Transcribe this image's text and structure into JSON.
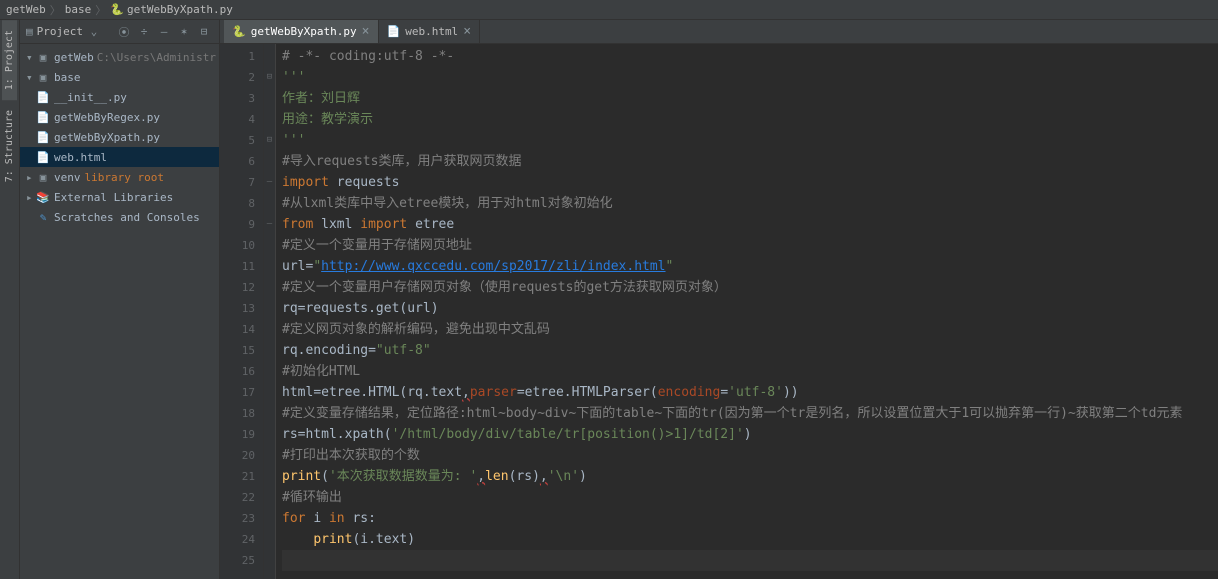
{
  "breadcrumb": {
    "root": "getWeb",
    "mid": "base",
    "leaf": "getWebByXpath.py"
  },
  "side_tabs": {
    "project": "1: Project",
    "structure": "7: Structure"
  },
  "panel": {
    "title": "Project",
    "btn_collapse": "⌄",
    "btn_target": "⦿",
    "btn_plus": "÷",
    "btn_minimize": "—",
    "btn_gear": "✶",
    "btn_hide": "⊟"
  },
  "tree": {
    "root": {
      "name": "getWeb",
      "hint": "C:\\Users\\Administr"
    },
    "base": "base",
    "init": "__init__.py",
    "regex": "getWebByRegex.py",
    "xpath": "getWebByXpath.py",
    "html": "web.html",
    "venv": "venv",
    "venv_hint": "library root",
    "ext": "External Libraries",
    "scratch": "Scratches and Consoles"
  },
  "tabs": {
    "t1": "getWebByXpath.py",
    "t2": "web.html",
    "close": "×"
  },
  "code": {
    "l1": "# -*- coding:utf-8 -*-",
    "l2": "'''",
    "l3_a": "作者：刘日辉",
    "l4_a": "用途：教学演示",
    "l5": "'''",
    "l6": "#导入requests类库，用户获取网页数据",
    "l7_kw": "import ",
    "l7_id": "requests",
    "l8": "#从lxml类库中导入etree模块，用于对html对象初始化",
    "l9_kw1": "from ",
    "l9_id1": "lxml ",
    "l9_kw2": "import ",
    "l9_id2": "etree",
    "l10": "#定义一个变量用于存储网页地址",
    "l11_a": "url",
    "l11_eq": "=",
    "l11_q": "\"",
    "l11_url": "http://www.qxccedu.com/sp2017/zli/index.html",
    "l11_q2": "\"",
    "l12": "#定义一个变量用户存储网页对象（使用requests的get方法获取网页对象）",
    "l13_a": "rq",
    "l13_b": "=requests.get(url)",
    "l14": "#定义网页对象的解析编码，避免出现中文乱码",
    "l15_a": "rq.encoding",
    "l15_b": "=",
    "l15_c": "\"utf-8\"",
    "l16": "#初始化HTML",
    "l17_a": "html",
    "l17_b": "=etree.HTML(rq.text",
    "l17_c": ",",
    "l17_d": "parser",
    "l17_e": "=etree.HTMLParser(",
    "l17_f": "encoding",
    "l17_g": "=",
    "l17_h": "'utf-8'",
    "l17_i": "))",
    "l18": "#定义变量存储结果，定位路径:html~body~div~下面的table~下面的tr(因为第一个tr是列名，所以设置位置大于1可以抛弃第一行)~获取第二个td元素",
    "l19_a": "rs",
    "l19_b": "=html.xpath(",
    "l19_c": "'/html/body/div/table/tr[position()>1]/td[2]'",
    "l19_d": ")",
    "l20": "#打印出本次获取的个数",
    "l21_a": "print",
    "l21_b": "(",
    "l21_c": "'本次获取数据数量为: '",
    "l21_d": ",",
    "l21_e": "len",
    "l21_f": "(rs)",
    "l21_g": ",",
    "l21_h": "'\\n'",
    "l21_i": ")",
    "l22": "#循环输出",
    "l23_a": "for ",
    "l23_b": "i ",
    "l23_c": "in ",
    "l23_d": "rs:",
    "l24_a": "    ",
    "l24_b": "print",
    "l24_c": "(i.text)"
  },
  "line_numbers": [
    "1",
    "2",
    "3",
    "4",
    "5",
    "6",
    "7",
    "8",
    "9",
    "10",
    "11",
    "12",
    "13",
    "14",
    "15",
    "16",
    "17",
    "18",
    "19",
    "20",
    "21",
    "22",
    "23",
    "24",
    "25"
  ]
}
